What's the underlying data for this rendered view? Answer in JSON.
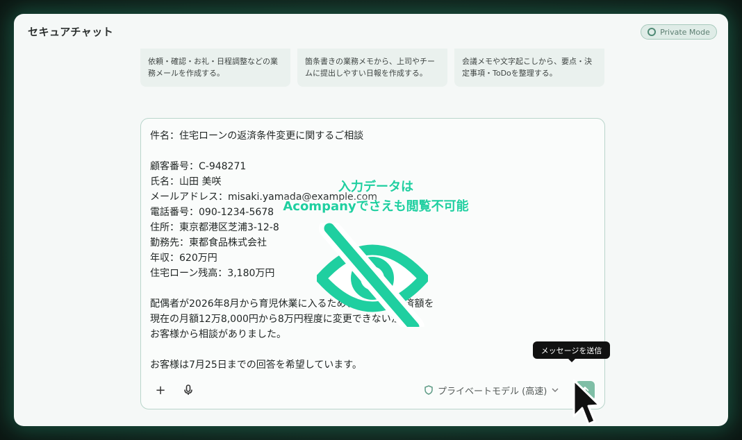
{
  "app": {
    "title": "セキュアチャット",
    "private_mode_label": "Private Mode"
  },
  "suggestions": [
    {
      "lines": [
        "依頼・確認・お礼・日程調整などの業",
        "務メールを作成する。"
      ]
    },
    {
      "lines": [
        "箇条書きの業務メモから、上司やチー",
        "ムに提出しやすい日報を作成する。"
      ]
    },
    {
      "lines": [
        "会議メモや文字起こしから、要点・決",
        "定事項・ToDoを整理する。"
      ]
    }
  ],
  "message": {
    "lines": [
      "件名：住宅ローンの返済条件変更に関するご相談",
      "",
      "顧客番号：C-948271",
      "氏名：山田 美咲",
      "メールアドレス：misaki.yamada@example.com",
      "電話番号：090-1234-5678",
      "住所：東京都港区芝浦3-12-8",
      "勤務先：東都食品株式会社",
      "年収：620万円",
      "住宅ローン残高：3,180万円",
      "",
      "配偶者が2026年8月から育児休業に入るため、半年間の返済額を",
      "現在の月額12万8,000円から8万円程度に変更できないか、",
      "お客様から相談がありました。",
      "",
      "お客様は7月25日までの回答を希望しています。"
    ]
  },
  "overlay": {
    "lines": [
      "入力データは",
      "Acompanyでさえも閲覧不可能"
    ],
    "color": "#1fcfa0",
    "icon": "eye-slash-icon"
  },
  "toolbar": {
    "add_icon": "plus-icon",
    "mic_icon": "microphone-icon",
    "model_label": "プライベートモデル (高速)",
    "send_tooltip": "メッセージを送信"
  },
  "colors": {
    "accent": "#7fbea6",
    "window_bg": "#f5f8f7",
    "page_bg": "#0f1c18"
  }
}
